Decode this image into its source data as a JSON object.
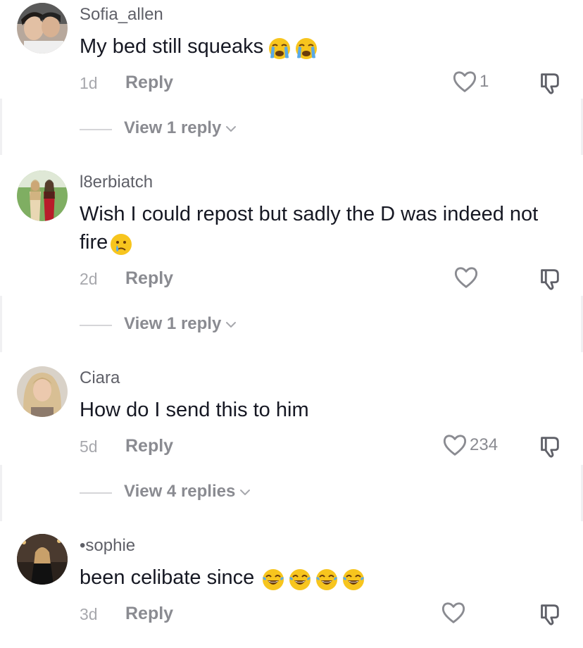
{
  "colors": {
    "text_primary": "#161823",
    "text_secondary": "#5f6068",
    "text_muted": "#a7a8ad",
    "action_gray": "#8a8b91"
  },
  "comments": [
    {
      "username": "Sofia_allen",
      "text": "My bed still squeaks",
      "emojis": [
        "loudly-crying-face-icon",
        "loudly-crying-face-icon"
      ],
      "timestamp": "1d",
      "reply_label": "Reply",
      "like_count": "1",
      "view_replies": "View 1 reply"
    },
    {
      "username": "l8erbiatch",
      "text": "Wish I could repost but sadly the D was indeed not fire",
      "emojis": [
        "sad-but-relieved-face-icon"
      ],
      "timestamp": "2d",
      "reply_label": "Reply",
      "like_count": "",
      "view_replies": "View 1 reply"
    },
    {
      "username": "Ciara",
      "text": "How do I send this to him",
      "emojis": [],
      "timestamp": "5d",
      "reply_label": "Reply",
      "like_count": "234",
      "view_replies": "View 4 replies"
    },
    {
      "username": "•sophie",
      "text": "been celibate since",
      "emojis": [
        "face-with-tears-of-joy-icon",
        "face-with-tears-of-joy-icon",
        "face-with-tears-of-joy-icon",
        "face-with-tears-of-joy-icon"
      ],
      "timestamp": "3d",
      "reply_label": "Reply",
      "like_count": ""
    }
  ]
}
